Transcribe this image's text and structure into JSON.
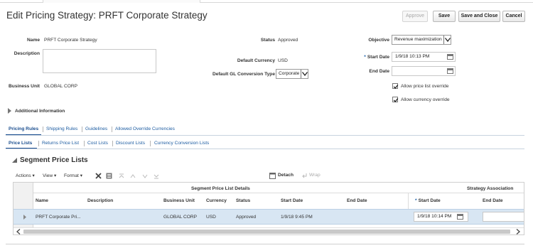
{
  "page": {
    "title": "Edit Pricing Strategy: PRFT Corporate Strategy"
  },
  "buttons": {
    "approve": "Approve",
    "save": "Save",
    "save_close": "Save and Close",
    "cancel": "Cancel"
  },
  "form": {
    "name_label": "Name",
    "name_value": "PRFT Corporate Strategy",
    "description_label": "Description",
    "business_unit_label": "Business Unit",
    "business_unit_value": "GLOBAL CORP",
    "status_label": "Status",
    "status_value": "Approved",
    "default_currency_label": "Default Currency",
    "default_currency_value": "USD",
    "gl_type_label": "Default GL Conversion Type",
    "gl_type_value": "Corporate",
    "objective_label": "Objective",
    "objective_value": "Revenue maximization",
    "start_date_label": "Start Date",
    "start_date_value": "1/9/18 10:13 PM",
    "end_date_label": "End Date",
    "end_date_value": "",
    "allow_price_list_override": "Allow price list override",
    "allow_currency_override": "Allow currency override"
  },
  "additional_info": "Additional Information",
  "tabs": [
    "Pricing Rules",
    "Shipping Rules",
    "Guidelines",
    "Allowed Override Currencies"
  ],
  "subtabs": [
    "Price Lists",
    "Returns Price List",
    "Cost Lists",
    "Discount Lists",
    "Currency Conversion Lists"
  ],
  "segment": {
    "title": "Segment Price Lists",
    "toolbar": {
      "actions": "Actions",
      "view": "View",
      "format": "Format",
      "detach": "Detach",
      "wrap": "Wrap"
    },
    "group_details": "Segment Price List Details",
    "group_strategy": "Strategy Association",
    "columns": [
      "Name",
      "Description",
      "Business Unit",
      "Currency",
      "Status",
      "Start Date",
      "End Date",
      "Start Date",
      "End Date"
    ],
    "row": {
      "name": "PRFT Corporate Pri...",
      "description": "",
      "business_unit": "GLOBAL CORP",
      "currency": "USD",
      "status": "Approved",
      "start_date": "1/9/18 9:45 PM",
      "end_date": "",
      "assoc_start_date": "1/9/18 10:14 PM",
      "assoc_end_date": ""
    }
  },
  "colors": {
    "link": "#1e5da2",
    "selected_row": "#d8e6f3"
  }
}
